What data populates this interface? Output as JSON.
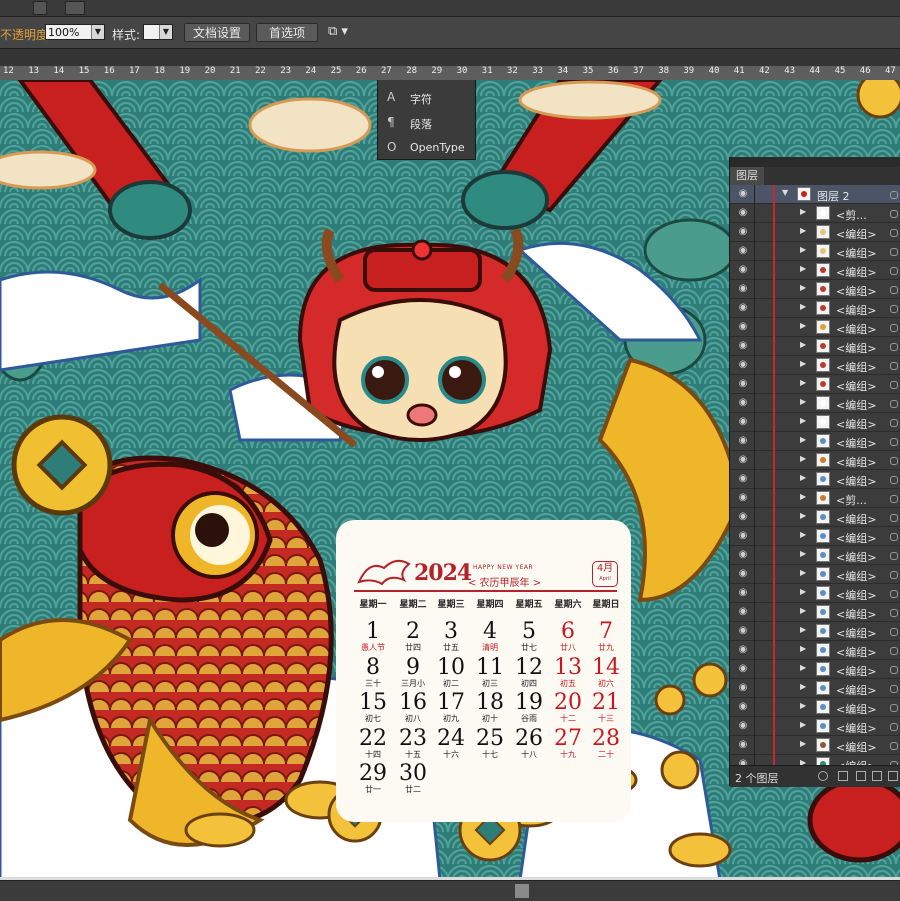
{
  "control_bar": {
    "opacity_label": "不透明度:",
    "opacity_value": "100%",
    "style_label": "样式:",
    "doc_settings_button": "文档设置",
    "preferences_button": "首选项"
  },
  "ruler": {
    "ticks": [
      "12",
      "13",
      "14",
      "15",
      "16",
      "17",
      "18",
      "19",
      "20",
      "21",
      "22",
      "23",
      "24",
      "25",
      "26",
      "27",
      "28",
      "29",
      "30",
      "31",
      "32",
      "33",
      "34",
      "35",
      "36",
      "37",
      "38",
      "39",
      "40",
      "41",
      "42",
      "43",
      "44",
      "45",
      "46",
      "47"
    ]
  },
  "character_panel": {
    "items": [
      {
        "icon": "A",
        "label": "字符"
      },
      {
        "icon": "¶",
        "label": "段落"
      },
      {
        "icon": "O",
        "label": "OpenType"
      }
    ]
  },
  "calendar": {
    "year": "2024",
    "happy_new_year": "HAPPY NEW YEAR",
    "lunar_year": "< 农历甲辰年 >",
    "month": "4月",
    "month_en": "April",
    "weekdays": [
      "星期一",
      "星期二",
      "星期三",
      "星期四",
      "星期五",
      "星期六",
      "星期日"
    ],
    "days": [
      {
        "n": "1",
        "s": "愚人节",
        "red_sub": true
      },
      {
        "n": "2",
        "s": "廿四"
      },
      {
        "n": "3",
        "s": "廿五"
      },
      {
        "n": "4",
        "s": "清明",
        "red_sub": true
      },
      {
        "n": "5",
        "s": "廿七"
      },
      {
        "n": "6",
        "s": "廿八",
        "red": true
      },
      {
        "n": "7",
        "s": "廿九",
        "red": true
      },
      {
        "n": "8",
        "s": "三十"
      },
      {
        "n": "9",
        "s": "三月小"
      },
      {
        "n": "10",
        "s": "初二"
      },
      {
        "n": "11",
        "s": "初三"
      },
      {
        "n": "12",
        "s": "初四"
      },
      {
        "n": "13",
        "s": "初五",
        "red": true
      },
      {
        "n": "14",
        "s": "初六",
        "red": true
      },
      {
        "n": "15",
        "s": "初七"
      },
      {
        "n": "16",
        "s": "初八"
      },
      {
        "n": "17",
        "s": "初九"
      },
      {
        "n": "18",
        "s": "初十"
      },
      {
        "n": "19",
        "s": "谷雨"
      },
      {
        "n": "20",
        "s": "十二",
        "red": true
      },
      {
        "n": "21",
        "s": "十三",
        "red": true
      },
      {
        "n": "22",
        "s": "十四"
      },
      {
        "n": "23",
        "s": "十五"
      },
      {
        "n": "24",
        "s": "十六"
      },
      {
        "n": "25",
        "s": "十七"
      },
      {
        "n": "26",
        "s": "十八"
      },
      {
        "n": "27",
        "s": "十九",
        "red": true
      },
      {
        "n": "28",
        "s": "二十",
        "red": true
      },
      {
        "n": "29",
        "s": "廿一"
      },
      {
        "n": "30",
        "s": "廿二"
      }
    ]
  },
  "layers_panel": {
    "tab_label": "图层",
    "top_layer": "图层 2",
    "rows": [
      {
        "name": "<剪...",
        "thumb": "#ffffff"
      },
      {
        "name": "<编组>",
        "thumb": "#e8c27a"
      },
      {
        "name": "<编组>",
        "thumb": "#e8c27a"
      },
      {
        "name": "<编组>",
        "thumb": "#c0392b"
      },
      {
        "name": "<编组>",
        "thumb": "#c0392b"
      },
      {
        "name": "<编组>",
        "thumb": "#c0392b"
      },
      {
        "name": "<编组>",
        "thumb": "#e0a030"
      },
      {
        "name": "<编组>",
        "thumb": "#c0392b"
      },
      {
        "name": "<编组>",
        "thumb": "#c0392b"
      },
      {
        "name": "<编组>",
        "thumb": "#c0392b"
      },
      {
        "name": "<编组>",
        "thumb": "#ffffff"
      },
      {
        "name": "<编组>",
        "thumb": "#ffffff"
      },
      {
        "name": "<编组>",
        "thumb": "#5b8fc7"
      },
      {
        "name": "<编组>",
        "thumb": "#d07a2e"
      },
      {
        "name": "<编组>",
        "thumb": "#5b8fc7"
      },
      {
        "name": "<剪...",
        "thumb": "#d07a2e"
      },
      {
        "name": "<编组>",
        "thumb": "#5b8fc7"
      },
      {
        "name": "<编组>",
        "thumb": "#5b8fc7"
      },
      {
        "name": "<编组>",
        "thumb": "#5b8fc7"
      },
      {
        "name": "<编组>",
        "thumb": "#5b8fc7"
      },
      {
        "name": "<编组>",
        "thumb": "#5b8fc7"
      },
      {
        "name": "<编组>",
        "thumb": "#5b8fc7"
      },
      {
        "name": "<编组>",
        "thumb": "#5b8fc7"
      },
      {
        "name": "<编组>",
        "thumb": "#5b8fc7"
      },
      {
        "name": "<编组>",
        "thumb": "#5b8fc7"
      },
      {
        "name": "<编组>",
        "thumb": "#5b8fc7"
      },
      {
        "name": "<编组>",
        "thumb": "#5b8fc7"
      },
      {
        "name": "<编组>",
        "thumb": "#5b8fc7"
      },
      {
        "name": "<编组>",
        "thumb": "#8a5a3a"
      },
      {
        "name": "<编组>",
        "thumb": "#2e8b6a"
      }
    ],
    "footer": "2 个图层"
  },
  "colors": {
    "accent_red": "#b3232b",
    "panel_bg": "#3c3c3c",
    "sea_teal": "#2e7f7a"
  }
}
